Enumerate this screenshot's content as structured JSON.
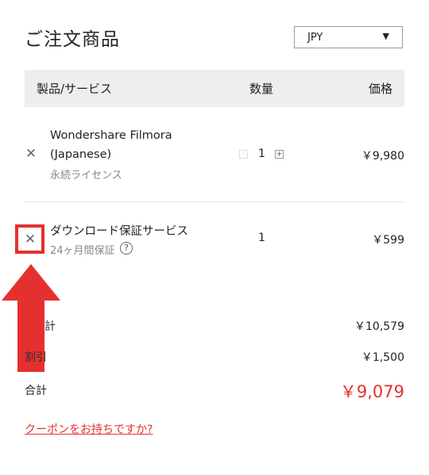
{
  "header": {
    "title": "ご注文商品"
  },
  "currency": {
    "selected": "JPY",
    "caret": "▼"
  },
  "table": {
    "col_product": "製品/サービス",
    "col_qty": "数量",
    "col_price": "価格"
  },
  "items": [
    {
      "name_line1": "Wondershare Filmora",
      "name_line2": "(Japanese)",
      "sub": "永続ライセンス",
      "qty": "1",
      "price": "￥9,980"
    },
    {
      "name_line1": "ダウンロード保証サービス",
      "sub": "24ヶ月間保証",
      "qty": "1",
      "price": "￥599"
    }
  ],
  "icons": {
    "remove": "✕",
    "minus": "−",
    "plus": "+",
    "help": "?"
  },
  "summary": {
    "subtotal_label_partial": "計",
    "subtotal_value": "￥10,579",
    "discount_label": "割引",
    "discount_value": "￥1,500",
    "total_label": "合計",
    "total_value": "￥9,079"
  },
  "coupon_link": "クーポンをお持ちですか?",
  "colors": {
    "accent": "#e53030",
    "header_bg": "#eeeeee"
  }
}
